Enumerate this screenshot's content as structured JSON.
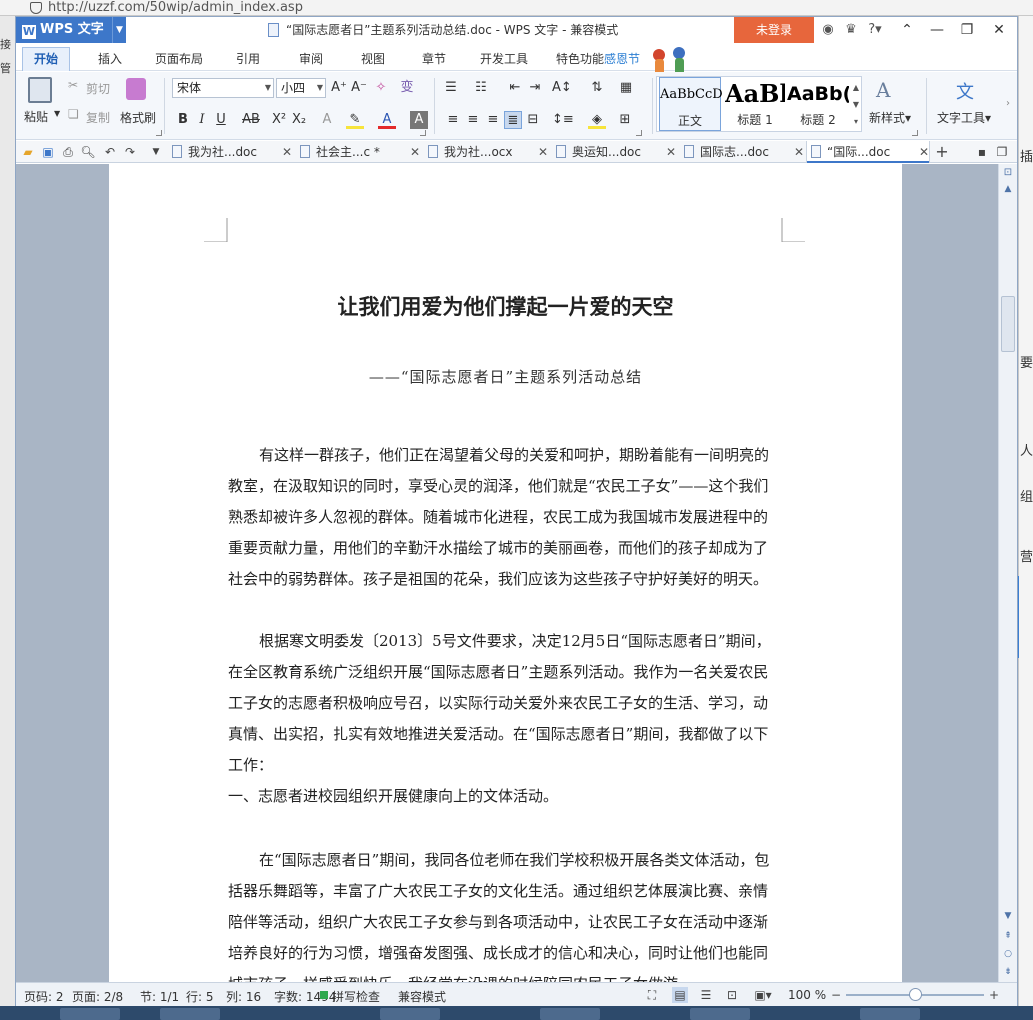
{
  "browser": {
    "url": "http://uzzf.com/50wip/admin_index.asp"
  },
  "titlebar": {
    "app_name": "WPS 文字",
    "title": "“国际志愿者日”主题系列活动总结.doc - WPS 文字 - 兼容模式",
    "login_label": "未登录"
  },
  "menu_tabs": [
    {
      "label": "开始",
      "active": true
    },
    {
      "label": "插入"
    },
    {
      "label": "页面布局"
    },
    {
      "label": "引用"
    },
    {
      "label": "审阅"
    },
    {
      "label": "视图"
    },
    {
      "label": "章节"
    },
    {
      "label": "开发工具"
    },
    {
      "label": "特色功能"
    },
    {
      "label": "感恩节"
    }
  ],
  "ribbon": {
    "paste_label": "粘贴",
    "cut_label": "剪切",
    "copy_label": "复制",
    "format_painter_label": "格式刷",
    "font_name": "宋体",
    "font_size": "小四",
    "styles": [
      {
        "preview": "AaBbCcD",
        "label": "正文"
      },
      {
        "preview": "AaBl",
        "label": "标题 1"
      },
      {
        "preview": "AaBb(",
        "label": "标题 2"
      }
    ],
    "new_style_label": "新样式",
    "text_tools_label": "文字工具"
  },
  "doc_tabs": [
    {
      "label": "我为社...doc"
    },
    {
      "label": "社会主...c *"
    },
    {
      "label": "我为社...ocx"
    },
    {
      "label": "奥运知...doc"
    },
    {
      "label": "国际志...doc"
    },
    {
      "label": "“国际...doc",
      "active": true
    }
  ],
  "document": {
    "title": "让我们用爱为他们撑起一片爱的天空",
    "subtitle": "——“国际志愿者日”主题系列活动总结",
    "paragraphs": [
      "有这样一群孩子，他们正在渴望着父母的关爱和呵护，期盼着能有一间明亮的教室，在汲取知识的同时，享受心灵的润泽，他们就是“农民工子女”——这个我们熟悉却被许多人忽视的群体。随着城市化进程，农民工成为我国城市发展进程中的重要贡献力量，用他们的辛勤汗水描绘了城市的美丽画卷，而他们的孩子却成为了社会中的弱势群体。孩子是祖国的花朵，我们应该为这些孩子守护好美好的明天。",
      "根据寒文明委发〔2013〕5号文件要求，决定12月5日“国际志愿者日”期间，在全区教育系统广泛组织开展“国际志愿者日”主题系列活动。我作为一名关爱农民工子女的志愿者积极响应号召，以实际行动关爱外来农民工子女的生活、学习，动真情、出实招，扎实有效地推进关爱活动。在“国际志愿者日”期间，我都做了以下工作：",
      "一、志愿者进校园组织开展健康向上的文体活动。",
      "在“国际志愿者日”期间，我同各位老师在我们学校积极开展各类文体活动，包括器乐舞蹈等，丰富了广大农民工子女的文化生活。通过组织艺体展演比赛、亲情陪伴等活动，组织广大农民工子女参与到各项活动中，让农民工子女在活动中逐渐培养良好的行为习惯，增强奋发图强、成长成才的信心和决心，同时让他们也能同城市孩子一样感受到快乐。我经常在没课的时候陪同农民工子女做游"
    ]
  },
  "statusbar": {
    "page_code": "页码: 2",
    "page": "页面: 2/8",
    "section": "节: 1/1",
    "row": "行: 5",
    "col": "列: 16",
    "word_count": "字数: 1494",
    "spellcheck": "拼写检查",
    "mode": "兼容模式",
    "zoom": "100 %"
  },
  "colors": {
    "accent": "#3d77c9",
    "login": "#e7663c"
  }
}
